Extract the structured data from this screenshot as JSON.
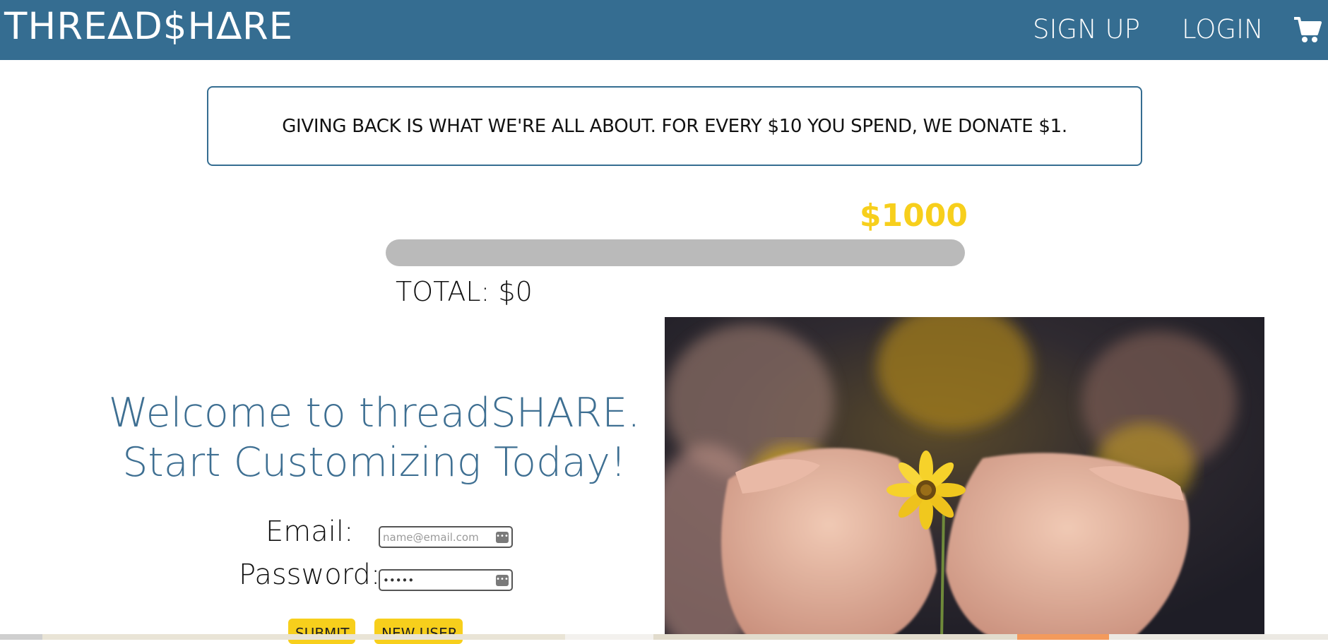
{
  "navbar": {
    "logo": "THRE∆D$H∆RE",
    "signup_label": "SIGN UP",
    "login_label": "LOGIN",
    "cart_icon": "cart-icon",
    "background": "#356d91"
  },
  "banner": {
    "text": "GIVING BACK IS WHAT WE'RE ALL ABOUT. FOR EVERY $10 YOU SPEND, WE DONATE $1."
  },
  "donation": {
    "goal_label": "$1000",
    "total_label": "TOTAL: $0",
    "progress_fraction": 0,
    "track_color": "#bababa",
    "accent_color": "#f7cf1c"
  },
  "welcome": {
    "line1": "Welcome to threadSHARE.",
    "line2": "Start Customizing Today!",
    "color": "#3e6f92"
  },
  "login_form": {
    "email_label": "Email:",
    "email_placeholder": "name@email.com",
    "password_label": "Password:",
    "password_value": "•••••",
    "submit_label": "SUBMIT",
    "new_user_label": "NEW USER"
  },
  "hero": {
    "image_icon": "hands-holding-flower-photo"
  }
}
